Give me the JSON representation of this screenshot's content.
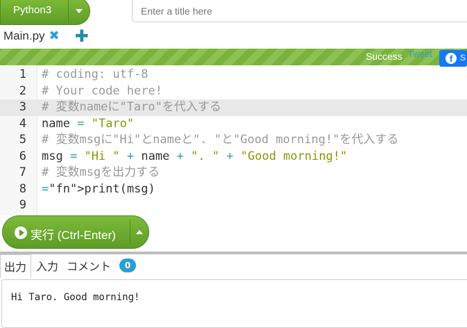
{
  "toolbar": {
    "language_label": "Python3",
    "title_placeholder": "Enter a title here"
  },
  "file_tab": {
    "name": "Main.py",
    "close_icon": "close-icon",
    "add_icon": "plus-icon"
  },
  "status_bar": {
    "status": "Success",
    "tweet": "Tweet",
    "facebook_label": "S"
  },
  "editor": {
    "line_numbers": [
      "1",
      "2",
      "3",
      "4",
      "5",
      "6",
      "7",
      "8",
      "9"
    ],
    "active_line": 3,
    "lines": [
      "# coding: utf-8",
      "# Your code here!",
      "# 変数nameに\"Taro\"を代入する",
      "name = \"Taro\"",
      "# 変数msgに\"Hi\"とnameと\". \"と\"Good morning!\"を代入する",
      "msg = \"Hi \" + name + \". \" + \"Good morning!\"",
      "# 変数msgを出力する",
      "print(msg)",
      ""
    ]
  },
  "run": {
    "label": "実行 (Ctrl-Enter)"
  },
  "output_tabs": {
    "output": "出力",
    "input": "入力",
    "comments": "コメント",
    "comment_count": "0"
  },
  "output": {
    "text": "Hi Taro. Good morning!"
  },
  "colors": {
    "accent_green": "#6aaa2e",
    "comment": "#999999",
    "string": "#859900",
    "operator": "#2aa198",
    "builtin": "#6c71c4",
    "badge": "#2a9fd6"
  }
}
